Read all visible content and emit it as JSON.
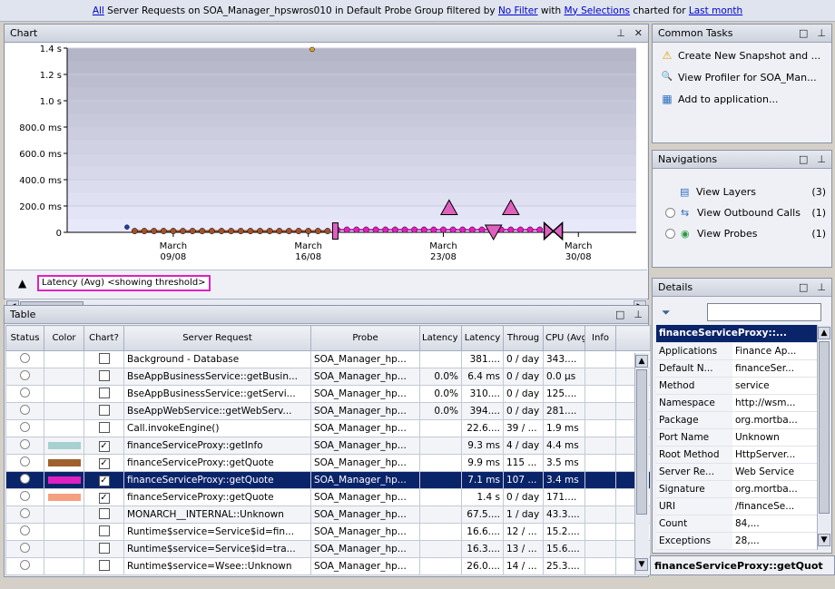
{
  "topbar": {
    "all": "All",
    "text1": " Server Requests on SOA_Manager_hpswros010 in Default Probe Group filtered by ",
    "no_filter": "No Filter",
    "text2": " with ",
    "my_selections": "My Selections",
    "text3": " charted for ",
    "last_month": "Last month"
  },
  "chart_panel": {
    "title": "Chart",
    "pin": "ᵖ",
    "close": "✕"
  },
  "chart_data": {
    "type": "line",
    "title": "",
    "xlabel": "",
    "ylabel": "",
    "y_ticks": [
      "1.4 s",
      "1.2 s",
      "1.0 s",
      "800.0 ms",
      "600.0 ms",
      "400.0 ms",
      "200.0 ms",
      "0"
    ],
    "y_tick_values": [
      1400,
      1200,
      1000,
      800,
      600,
      400,
      200,
      0
    ],
    "ylim": [
      0,
      1400
    ],
    "x_ticks": [
      {
        "l1": "March",
        "l2": "09/08",
        "day": 9
      },
      {
        "l1": "March",
        "l2": "16/08",
        "day": 16
      },
      {
        "l1": "March",
        "l2": "23/08",
        "day": 23
      },
      {
        "l1": "March",
        "l2": "30/08",
        "day": 30
      }
    ],
    "xlim_days": [
      3.5,
      33
    ],
    "series": [
      {
        "name": "Latency (Avg)",
        "color": "#e020c0",
        "x": [
          17.5,
          18,
          18.5,
          19,
          19.5,
          20,
          20.5,
          21,
          21.5,
          22,
          22.5,
          23,
          23.5,
          24,
          24.5,
          25,
          25.5,
          26,
          26.5,
          27,
          27.5,
          28
        ],
        "y": [
          20,
          20,
          20,
          20,
          20,
          20,
          20,
          20,
          20,
          20,
          20,
          20,
          20,
          20,
          20,
          20,
          20,
          20,
          20,
          20,
          20,
          20
        ]
      },
      {
        "name": "",
        "color": "#a0522d",
        "x": [
          7,
          7.5,
          8,
          8.5,
          9,
          9.5,
          10,
          10.5,
          11,
          11.5,
          12,
          12.5,
          13,
          13.5,
          14,
          14.5,
          15,
          15.5,
          16,
          16.5,
          17
        ],
        "y": [
          10,
          10,
          10,
          10,
          10,
          10,
          10,
          10,
          10,
          10,
          10,
          10,
          10,
          10,
          10,
          10,
          10,
          10,
          10,
          10,
          10
        ]
      }
    ],
    "markers": [
      {
        "shape": "triangle-up",
        "x": 23.3,
        "y": 190,
        "color": "#e060c0"
      },
      {
        "shape": "triangle-up",
        "x": 26.5,
        "y": 190,
        "color": "#e060c0"
      },
      {
        "shape": "triangle-down",
        "x": 25.6,
        "y": 0,
        "color": "#e060c0"
      },
      {
        "shape": "bar",
        "x": 17.4,
        "y": 10,
        "color": "#e060c0"
      },
      {
        "shape": "bowtie",
        "x": 28.7,
        "y": 10,
        "color": "#e060c0"
      },
      {
        "shape": "dot",
        "x": 16.2,
        "y": 1390,
        "color": "#e0a020"
      },
      {
        "shape": "dot",
        "x": 6.6,
        "y": 40,
        "color": "#2040a0"
      }
    ]
  },
  "legend": {
    "label": "Latency (Avg) <showing threshold>"
  },
  "table_panel": {
    "title": "Table",
    "columns": [
      "Status",
      "Color",
      "Chart?",
      "Server Request",
      "Probe",
      "Latency Over Th",
      "Latency",
      "Throug",
      "CPU (Avg)",
      "Info"
    ],
    "sort_indicator": "▲1",
    "rows": [
      {
        "color": "",
        "chart": false,
        "request": "Background - Database",
        "probe": "SOA_Manager_hp...",
        "over": "",
        "latency": "381....",
        "through": "0 / day",
        "cpu": "343...."
      },
      {
        "color": "",
        "chart": false,
        "request": "BseAppBusinessService::getBusin...",
        "probe": "SOA_Manager_hp...",
        "over": "0.0%",
        "latency": "6.4 ms",
        "through": "0 / day",
        "cpu": "0.0 µs"
      },
      {
        "color": "",
        "chart": false,
        "request": "BseAppBusinessService::getServi...",
        "probe": "SOA_Manager_hp...",
        "over": "0.0%",
        "latency": "310....",
        "through": "0 / day",
        "cpu": "125...."
      },
      {
        "color": "",
        "chart": false,
        "request": "BseAppWebService::getWebServ...",
        "probe": "SOA_Manager_hp...",
        "over": "0.0%",
        "latency": "394....",
        "through": "0 / day",
        "cpu": "281...."
      },
      {
        "color": "",
        "chart": false,
        "request": "Call.invokeEngine()",
        "probe": "SOA_Manager_hp...",
        "over": "",
        "latency": "22.6....",
        "through": "39 / ...",
        "cpu": "1.9 ms"
      },
      {
        "color": "#a8d0d0",
        "chart": true,
        "request": "financeServiceProxy::getInfo",
        "probe": "SOA_Manager_hp...",
        "over": "",
        "latency": "9.3 ms",
        "through": "4 / day",
        "cpu": "4.4 ms"
      },
      {
        "color": "#a0622d",
        "chart": true,
        "request": "financeServiceProxy::getQuote",
        "probe": "SOA_Manager_hp...",
        "over": "",
        "latency": "9.9 ms",
        "through": "115 ...",
        "cpu": "3.5 ms"
      },
      {
        "color": "#e020c0",
        "chart": true,
        "request": "financeServiceProxy::getQuote",
        "probe": "SOA_Manager_hp...",
        "over": "",
        "latency": "7.1 ms",
        "through": "107 ...",
        "cpu": "3.4 ms",
        "selected": true
      },
      {
        "color": "#f5a080",
        "chart": true,
        "request": "financeServiceProxy::getQuote",
        "probe": "SOA_Manager_hp...",
        "over": "",
        "latency": "1.4 s",
        "through": "0 / day",
        "cpu": "171...."
      },
      {
        "color": "",
        "chart": false,
        "request": "MONARCH__INTERNAL::Unknown",
        "probe": "SOA_Manager_hp...",
        "over": "",
        "latency": "67.5....",
        "through": "1 / day",
        "cpu": "43.3...."
      },
      {
        "color": "",
        "chart": false,
        "request": "Runtime$service=Service$id=fin...",
        "probe": "SOA_Manager_hp...",
        "over": "",
        "latency": "16.6....",
        "through": "12 / ...",
        "cpu": "15.2...."
      },
      {
        "color": "",
        "chart": false,
        "request": "Runtime$service=Service$id=tra...",
        "probe": "SOA_Manager_hp...",
        "over": "",
        "latency": "16.3....",
        "through": "13 / ...",
        "cpu": "15.6...."
      },
      {
        "color": "",
        "chart": false,
        "request": "Runtime$service=Wsee::Unknown",
        "probe": "SOA_Manager_hp...",
        "over": "",
        "latency": "26.0....",
        "through": "14 / ...",
        "cpu": "25.3...."
      }
    ]
  },
  "common_tasks": {
    "title": "Common Tasks",
    "items": [
      {
        "icon": "⚠",
        "label": "Create New Snapshot and ..."
      },
      {
        "icon": "🔍",
        "label": "View Profiler for SOA_Man..."
      },
      {
        "icon": "▦",
        "label": "Add to application..."
      }
    ]
  },
  "navigations": {
    "title": "Navigations",
    "items": [
      {
        "label": "View Layers",
        "count": "(3)"
      },
      {
        "label": "View Outbound Calls",
        "count": "(1)"
      },
      {
        "label": "View Probes",
        "count": "(1)"
      }
    ]
  },
  "details": {
    "title": "Details",
    "header": "financeServiceProxy::...",
    "rows": [
      {
        "k": "Applications",
        "v": "Finance Ap..."
      },
      {
        "k": "Default N...",
        "v": "financeSer..."
      },
      {
        "k": "Method",
        "v": "service"
      },
      {
        "k": "Namespace",
        "v": "http://wsm..."
      },
      {
        "k": "Package",
        "v": "org.mortba..."
      },
      {
        "k": "Port Name",
        "v": "Unknown"
      },
      {
        "k": "Root Method",
        "v": "HttpServer..."
      },
      {
        "k": "Server Re...",
        "v": "Web Service"
      },
      {
        "k": "Signature",
        "v": "org.mortba..."
      },
      {
        "k": "URI",
        "v": "/financeSe..."
      },
      {
        "k": "Count",
        "v": "84,..."
      },
      {
        "k": "Exceptions",
        "v": "28,..."
      }
    ],
    "status": "financeServiceProxy::getQuot"
  }
}
